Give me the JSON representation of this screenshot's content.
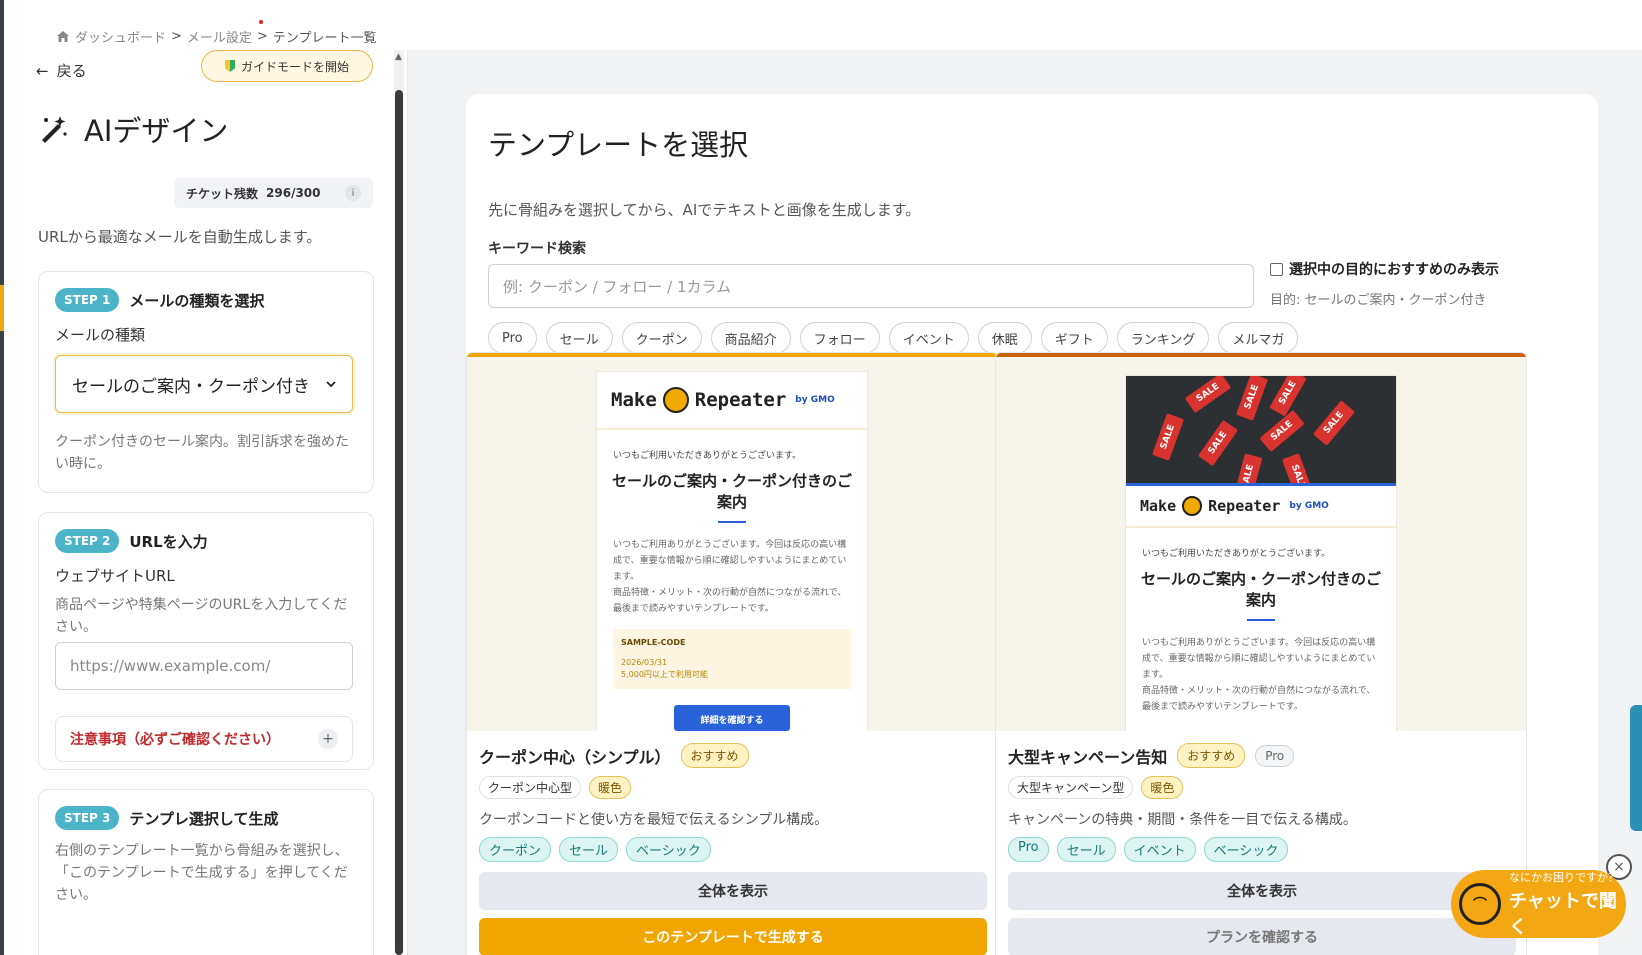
{
  "breadcrumb": {
    "items": [
      "ダッシュボード",
      "メール設定",
      "テンプレート一覧"
    ],
    "separator": ">"
  },
  "sidebar": {
    "back_label": "戻る",
    "guide_button": "ガイドモードを開始",
    "title": "AIデザイン",
    "ticket": {
      "label": "チケット残数",
      "value": "296/300",
      "info": "i"
    },
    "description": "URLから最適なメールを自動生成します。",
    "step1": {
      "pill": "STEP 1",
      "title": "メールの種類を選択",
      "field_label": "メールの種類",
      "selected": "セールのご案内・クーポン付き",
      "help": "クーポン付きのセール案内。割引訴求を強めたい時に。"
    },
    "step2": {
      "pill": "STEP 2",
      "title": "URLを入力",
      "field_label": "ウェブサイトURL",
      "help": "商品ページや特集ページのURLを入力してください。",
      "placeholder": "https://www.example.com/",
      "notice": "注意事項（必ずご確認ください）",
      "notice_toggle": "+"
    },
    "step3": {
      "pill": "STEP 3",
      "title": "テンプレ選択して生成",
      "help": "右側のテンプレート一覧から骨組みを選択し、「このテンプレートで生成する」を押してください。"
    }
  },
  "main": {
    "title": "テンプレートを選択",
    "description": "先に骨組みを選択してから、AIでテキストと画像を生成します。",
    "keyword_label": "キーワード検索",
    "keyword_placeholder": "例: クーポン / フォロー / 1カラム",
    "only_recommended": "選択中の目的におすすめのみ表示",
    "purpose": "目的: セールのご案内・クーポン付き",
    "chips": [
      "Pro",
      "セール",
      "クーポン",
      "商品紹介",
      "フォロー",
      "イベント",
      "休眠",
      "ギフト",
      "ランキング",
      "メルマガ"
    ]
  },
  "templates": [
    {
      "preview": {
        "logo": "Make",
        "logo2": "Repeater",
        "logo_by": "by GMO",
        "greeting": "いつもご利用いただきありがとうございます。",
        "headline": "セールのご案内・クーポン付きのご案内",
        "body1": "いつもご利用ありがとうございます。今回は反応の高い構成で、重要な情報から順に確認しやすいようにまとめています。",
        "body2": "商品特徴・メリット・次の行動が自然につながる流れで、最後まで読みやすいテンプレートです。",
        "coupon_code": "SAMPLE-CODE",
        "coupon_date": "2026/03/31",
        "coupon_cond": "5,000円以上で利用可能",
        "button": "詳細を確認する"
      },
      "name": "クーポン中心（シンプル）",
      "badge_rec": "おすすめ",
      "type": "クーポン中心型",
      "tone": "暖色",
      "description": "クーポンコードと使い方を最短で伝えるシンプル構成。",
      "tags": [
        "クーポン",
        "セール",
        "ベーシック"
      ],
      "btn_full": "全体を表示",
      "btn_action": "このテンプレートで生成する"
    },
    {
      "preview": {
        "sale_tag": "SALE",
        "logo": "Make",
        "logo2": "Repeater",
        "logo_by": "by GMO",
        "greeting": "いつもご利用いただきありがとうございます。",
        "headline": "セールのご案内・クーポン付きのご案内",
        "body1": "いつもご利用ありがとうございます。今回は反応の高い構成で、重要な情報から順に確認しやすいようにまとめています。",
        "body2": "商品特徴・メリット・次の行動が自然につながる流れで、最後まで読みやすいテンプレートです。"
      },
      "name": "大型キャンペーン告知",
      "badge_rec": "おすすめ",
      "badge_pro": "Pro",
      "type": "大型キャンペーン型",
      "tone": "暖色",
      "description": "キャンペーンの特典・期間・条件を一目で伝える構成。",
      "tags": [
        "Pro",
        "セール",
        "イベント",
        "ベーシック"
      ],
      "btn_full": "全体を表示",
      "btn_action": "プランを確認する"
    }
  ],
  "chat": {
    "small": "なにかお困りですか？",
    "big": "チャットで聞く",
    "close": "×"
  },
  "colors": {
    "accent": "#f0a500",
    "step_pill": "#4bb4c8",
    "tag_teal": "#dcf5f3",
    "notice_red": "#c0292b"
  }
}
